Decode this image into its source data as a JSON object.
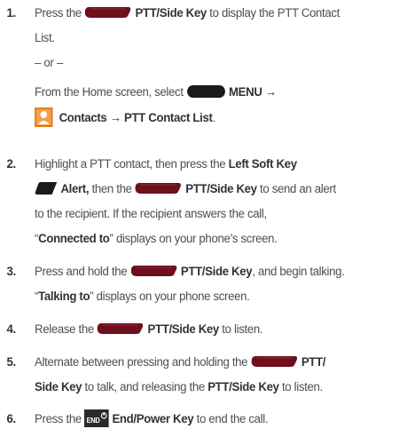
{
  "steps": [
    {
      "number": "1.",
      "lines": {
        "l1_pre": "Press the",
        "l1_key": "PTT/Side Key",
        "l1_post": "to display the PTT Contact",
        "l2": "List.",
        "or": "– or –",
        "l4_pre": "From the Home screen, select",
        "l4_key": "MENU →",
        "l5_key": "Contacts → PTT Contact List",
        "l5_post": "."
      }
    },
    {
      "number": "2.",
      "lines": {
        "l1_pre": "Highlight a PTT contact, then press the",
        "l1_key": "Left Soft Key",
        "l2_key1": "Alert,",
        "l2_mid": "then the",
        "l2_key2": "PTT/Side Key",
        "l2_post": "to send an alert",
        "l3": "to the recipient. If the recipient answers the call,",
        "l4_open": "“",
        "l4_key": "Connected to",
        "l4_post": "” displays on your phone’s screen."
      }
    },
    {
      "number": "3.",
      "lines": {
        "l1_pre": "Press and hold the",
        "l1_key": "PTT/Side Key",
        "l1_post": ", and begin talking.",
        "l2_open": "“",
        "l2_key": "Talking to",
        "l2_post": "” displays on your phone screen."
      }
    },
    {
      "number": "4.",
      "lines": {
        "l1_pre": "Release the",
        "l1_key": "PTT/Side Key",
        "l1_post": "to listen."
      }
    },
    {
      "number": "5.",
      "lines": {
        "l1_pre": "Alternate between pressing and holding the",
        "l1_key": "PTT/",
        "l2_key1": "Side Key",
        "l2_mid": "to talk, and releasing the",
        "l2_key2": "PTT/Side Key",
        "l2_post": "to listen."
      }
    },
    {
      "number": "6.",
      "lines": {
        "l1_pre": "Press the",
        "l1_key": "End/Power Key",
        "l1_post": "to end the call."
      }
    }
  ],
  "icons": {
    "ptt_key": "ptt-side-key-icon",
    "menu_key": "menu-key-icon",
    "contacts": "contacts-icon",
    "left_soft_key": "left-soft-key-icon",
    "end_key": "end-power-key-icon",
    "end_key_label": "END",
    "colors": {
      "key_red": "#6e0f1c",
      "key_dark": "#1b1b1b",
      "contacts_orange": "#e87a1e"
    }
  }
}
